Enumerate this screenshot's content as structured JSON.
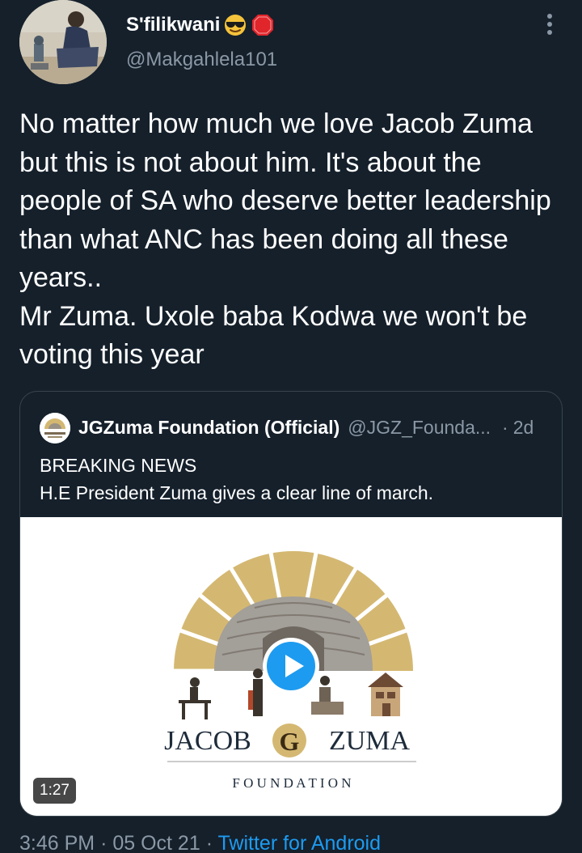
{
  "tweet": {
    "display_name": "S'filikwani",
    "display_name_emojis": [
      "smiling-face-with-sunglasses-emoji",
      "stop-sign-emoji"
    ],
    "handle": "@Makgahlela101",
    "text": "No matter how much we love Jacob Zuma but this is not about him. It's about the people of SA who deserve better leadership than what ANC has been doing all these years..\nMr Zuma. Uxole baba Kodwa we won't be voting this year",
    "time": "3:46 PM",
    "date": "05 Oct 21",
    "separator": "·",
    "source": "Twitter for Android"
  },
  "quoted_tweet": {
    "name": "JGZuma Foundation (Official)",
    "handle": "@JGZ_Founda...",
    "separator": "·",
    "time": "2d",
    "text": "BREAKING NEWS\nH.E President Zuma gives a clear line of march.",
    "media": {
      "type": "video",
      "duration": "1:27",
      "logo_line1_left": "JACOB",
      "logo_initial": "G",
      "logo_line1_right": "ZUMA",
      "logo_line2": "F O U N D A T I O N"
    }
  },
  "colors": {
    "background": "#15202b",
    "text_primary": "#ffffff",
    "text_secondary": "#8b98a5",
    "accent_blue": "#1d9bf0",
    "border": "#38444d",
    "logo_gold": "#d4b872"
  },
  "icons": {
    "more": "more-vertical-icon",
    "play": "play-icon"
  }
}
